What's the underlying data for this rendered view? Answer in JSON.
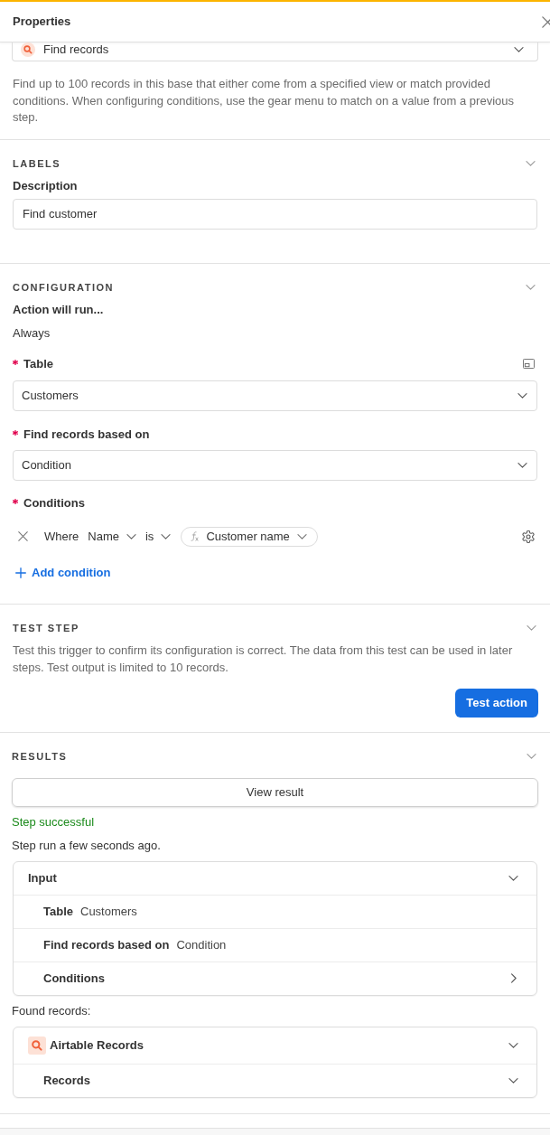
{
  "panel": {
    "title": "Properties"
  },
  "action": {
    "value": "Find records",
    "description": "Find up to 100 records in this base that either come from a specified view or match provided conditions. When configuring conditions, use the gear menu to match on a value from a previous step."
  },
  "labels": {
    "heading": "LABELS",
    "expanded": true,
    "field_label": "Description",
    "field_value": "Find customer"
  },
  "configuration": {
    "heading": "CONFIGURATION",
    "expanded": true,
    "run_label": "Action will run...",
    "run_value": "Always",
    "table": {
      "label": "Table",
      "required": true,
      "value": "Customers"
    },
    "find_based_on": {
      "label": "Find records based on",
      "required": true,
      "value": "Condition"
    },
    "conditions": {
      "label": "Conditions",
      "required": true,
      "rows": [
        {
          "prefix": "Where",
          "field": "Name",
          "operator": "is",
          "value": "Customer name"
        }
      ],
      "add_label": "Add condition"
    }
  },
  "test_step": {
    "heading": "TEST STEP",
    "expanded": true,
    "description": "Test this trigger to confirm its configuration is correct. The data from this test can be used in later steps. Test output is limited to 10 records.",
    "button": "Test action"
  },
  "results": {
    "heading": "RESULTS",
    "expanded": true,
    "view_button": "View result",
    "status": {
      "text": "Step successful",
      "kind": "success"
    },
    "run_time": "Step run a few seconds ago.",
    "input": {
      "title": "Input",
      "expanded": true,
      "rows": [
        {
          "kind": "pair",
          "label": "Table",
          "value": "Customers"
        },
        {
          "kind": "pair",
          "label": "Find records based on",
          "value": "Condition"
        },
        {
          "kind": "collapsible",
          "label": "Conditions",
          "expanded": false
        }
      ]
    },
    "found_label": "Found records:",
    "found": {
      "title": "Airtable Records",
      "expanded": true,
      "rows": [
        {
          "label": "Records",
          "expanded": true
        }
      ]
    }
  }
}
